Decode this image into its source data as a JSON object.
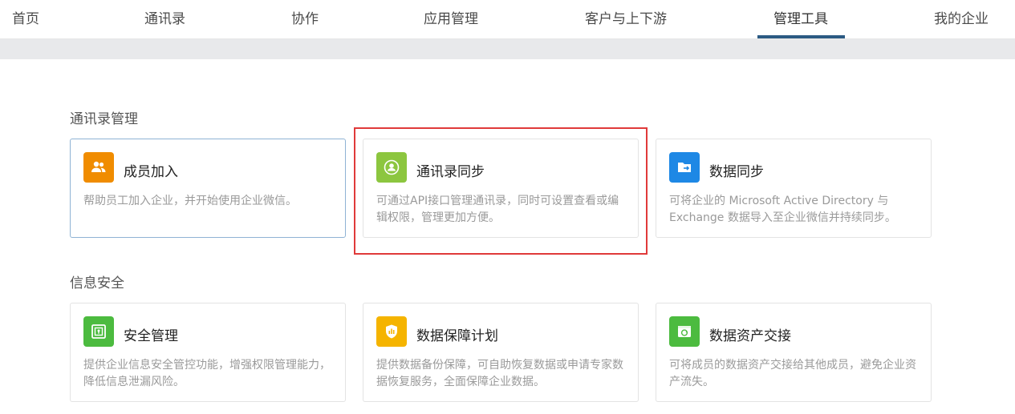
{
  "nav": {
    "items": [
      "首页",
      "通讯录",
      "协作",
      "应用管理",
      "客户与上下游",
      "管理工具",
      "我的企业"
    ],
    "active": "管理工具"
  },
  "sections": [
    {
      "title": "通讯录管理",
      "cards": [
        {
          "title": "成员加入",
          "desc": "帮助员工加入企业，并开始使用企业微信。",
          "icon": "users-icon",
          "color": "#f08c00"
        },
        {
          "title": "通讯录同步",
          "desc": "可通过API接口管理通讯录，同时可设置查看或编辑权限，管理更加方便。",
          "icon": "sync-contact-icon",
          "color": "#8cc63f"
        },
        {
          "title": "数据同步",
          "desc": "可将企业的 Microsoft Active Directory 与 Exchange 数据导入至企业微信并持续同步。",
          "icon": "folder-icon",
          "color": "#1e88e5"
        }
      ]
    },
    {
      "title": "信息安全",
      "cards": [
        {
          "title": "安全管理",
          "desc": "提供企业信息安全管控功能，增强权限管理能力，降低信息泄漏风险。",
          "icon": "safe-icon",
          "color": "#4cbb3f"
        },
        {
          "title": "数据保障计划",
          "desc": "提供数据备份保障，可自助恢复数据或申请专家数据恢复服务，全面保障企业数据。",
          "icon": "shield-chart-icon",
          "color": "#f5b400"
        },
        {
          "title": "数据资产交接",
          "desc": "可将成员的数据资产交接给其他成员，避免企业资产流失。",
          "icon": "transfer-icon",
          "color": "#4cbb3f"
        }
      ]
    }
  ],
  "colors": {
    "accent": "#2b5a83",
    "highlight": "#e03a3a"
  }
}
